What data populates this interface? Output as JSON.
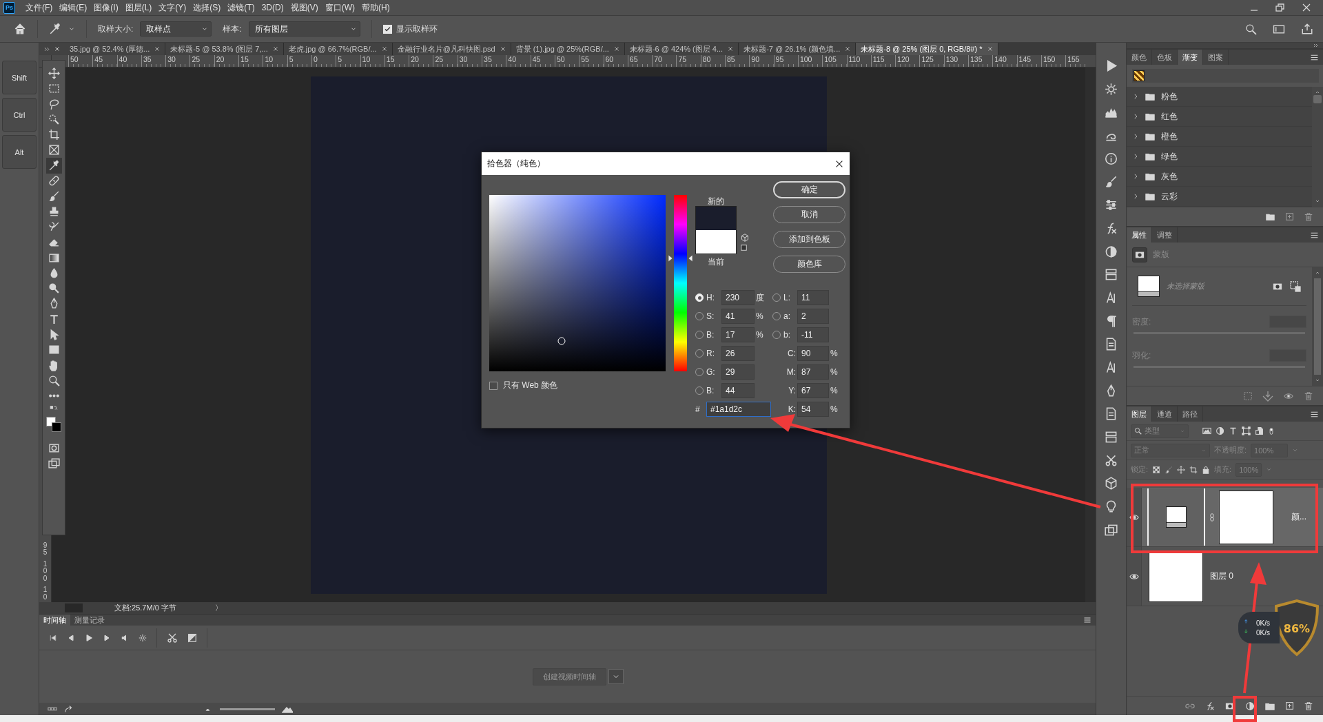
{
  "menu_bar": {
    "logo": "Ps",
    "items": [
      "文件(F)",
      "编辑(E)",
      "图像(I)",
      "图层(L)",
      "文字(Y)",
      "选择(S)",
      "滤镜(T)",
      "3D(D)",
      "视图(V)",
      "窗口(W)",
      "帮助(H)"
    ]
  },
  "options_bar": {
    "sample_size_label": "取样大小:",
    "sample_size": "取样点",
    "sample_label": "样本:",
    "sample": "所有图层",
    "show_ring": {
      "label": "显示取样环",
      "checked": true
    }
  },
  "shortcut_keys": [
    "Shift",
    "Ctrl",
    "Alt"
  ],
  "document_tabs": [
    {
      "label": "35.jpg @ 52.4% (厚德...",
      "selected": false
    },
    {
      "label": "未标题-5 @ 53.8% (图层 7,...",
      "selected": false
    },
    {
      "label": "老虎.jpg @ 66.7%(RGB/...",
      "selected": false
    },
    {
      "label": "金融行业名片@凡科快图.psd",
      "selected": false
    },
    {
      "label": "背景 (1).jpg @ 25%(RGB/...",
      "selected": false
    },
    {
      "label": "未标题-6 @ 424% (图层 4...",
      "selected": false
    },
    {
      "label": "未标题-7 @ 26.1% (颜色填...",
      "selected": false
    },
    {
      "label": "未标题-8 @ 25% (图层 0, RGB/8#) *",
      "selected": true
    }
  ],
  "ruler": {
    "horizontal": [
      "50",
      "45",
      "40",
      "35",
      "30",
      "25",
      "20",
      "15",
      "10",
      "5",
      "0",
      "5",
      "10",
      "15",
      "20",
      "25",
      "30",
      "35",
      "40",
      "45",
      "50",
      "55",
      "60",
      "65",
      "70",
      "75",
      "80",
      "85",
      "90",
      "95",
      "100",
      "105",
      "110",
      "115",
      "120",
      "125",
      "130",
      "135",
      "140",
      "145",
      "150",
      "155"
    ],
    "vertical": [
      "95",
      "100",
      "10"
    ]
  },
  "status_bar": {
    "doc_info": "文档:25.7M/0 字节",
    "arrow": "〉"
  },
  "timeline": {
    "tabs": [
      {
        "label": "时间轴",
        "selected": true
      },
      {
        "label": "测量记录",
        "selected": false
      }
    ],
    "create_button": "创建视频时间轴",
    "zoom_slider": {
      "level": 1
    }
  },
  "color_picker": {
    "title": "拾色器（纯色）",
    "new_label": "新的",
    "current_label": "当前",
    "buttons": [
      {
        "label": "确定",
        "default": true
      },
      {
        "label": "取消",
        "default": false
      },
      {
        "label": "添加到色板",
        "default": false
      },
      {
        "label": "颜色库",
        "default": false
      }
    ],
    "web_only": {
      "label": "只有 Web 颜色",
      "checked": false
    },
    "hue_slider": {
      "level": 0.64
    },
    "hsb": [
      {
        "label": "H:",
        "value": "230",
        "unit": "度",
        "selected": true
      },
      {
        "label": "S:",
        "value": "41",
        "unit": "%",
        "selected": false
      },
      {
        "label": "B:",
        "value": "17",
        "unit": "%",
        "selected": false
      }
    ],
    "lab": [
      {
        "label": "L:",
        "value": "11",
        "selected": false
      },
      {
        "label": "a:",
        "value": "2",
        "selected": false
      },
      {
        "label": "b:",
        "value": "-11",
        "selected": false
      }
    ],
    "rgb": [
      {
        "label": "R:",
        "value": "26",
        "selected": false
      },
      {
        "label": "G:",
        "value": "29",
        "selected": false
      },
      {
        "label": "B:",
        "value": "44",
        "selected": false
      }
    ],
    "cmyk": [
      {
        "label": "C:",
        "value": "90",
        "unit": "%"
      },
      {
        "label": "M:",
        "value": "87",
        "unit": "%"
      },
      {
        "label": "Y:",
        "value": "67",
        "unit": "%"
      },
      {
        "label": "K:",
        "value": "54",
        "unit": "%"
      }
    ],
    "hex": {
      "label": "#",
      "value": "#1a1d2c"
    }
  },
  "gradients_panel": {
    "tabs": [
      {
        "label": "颜色",
        "selected": false
      },
      {
        "label": "色板",
        "selected": false
      },
      {
        "label": "渐变",
        "selected": true
      },
      {
        "label": "图案",
        "selected": false
      }
    ],
    "groups": [
      {
        "name": "粉色",
        "expanded": false
      },
      {
        "name": "红色",
        "expanded": false
      },
      {
        "name": "橙色",
        "expanded": false
      },
      {
        "name": "绿色",
        "expanded": false
      },
      {
        "name": "灰色",
        "expanded": false
      },
      {
        "name": "云彩",
        "expanded": false
      }
    ]
  },
  "properties_panel": {
    "tabs": [
      {
        "label": "属性",
        "selected": true
      },
      {
        "label": "调整",
        "selected": false
      }
    ],
    "type": "蒙版",
    "mask": "未选择蒙版",
    "density_label": "密度:",
    "feather_label": "羽化:"
  },
  "layers_panel": {
    "tabs": [
      {
        "label": "图层",
        "selected": true
      },
      {
        "label": "通道",
        "selected": false
      },
      {
        "label": "路径",
        "selected": false
      }
    ],
    "filter_placeholder": "类型",
    "blend_mode": "正常",
    "opacity_label": "不透明度:",
    "opacity": "100%",
    "lock_label": "锁定:",
    "fill_label": "填充:",
    "fill": "100%",
    "layers": [
      {
        "name": "颜...",
        "kind": "adjustment",
        "visible": true,
        "selected": true
      },
      {
        "name": "图层 0",
        "kind": "pixel",
        "visible": true,
        "selected": false
      }
    ]
  },
  "net_widget": {
    "upload": "0K/s",
    "download": "0K/s"
  },
  "badge": {
    "text": "86%"
  }
}
